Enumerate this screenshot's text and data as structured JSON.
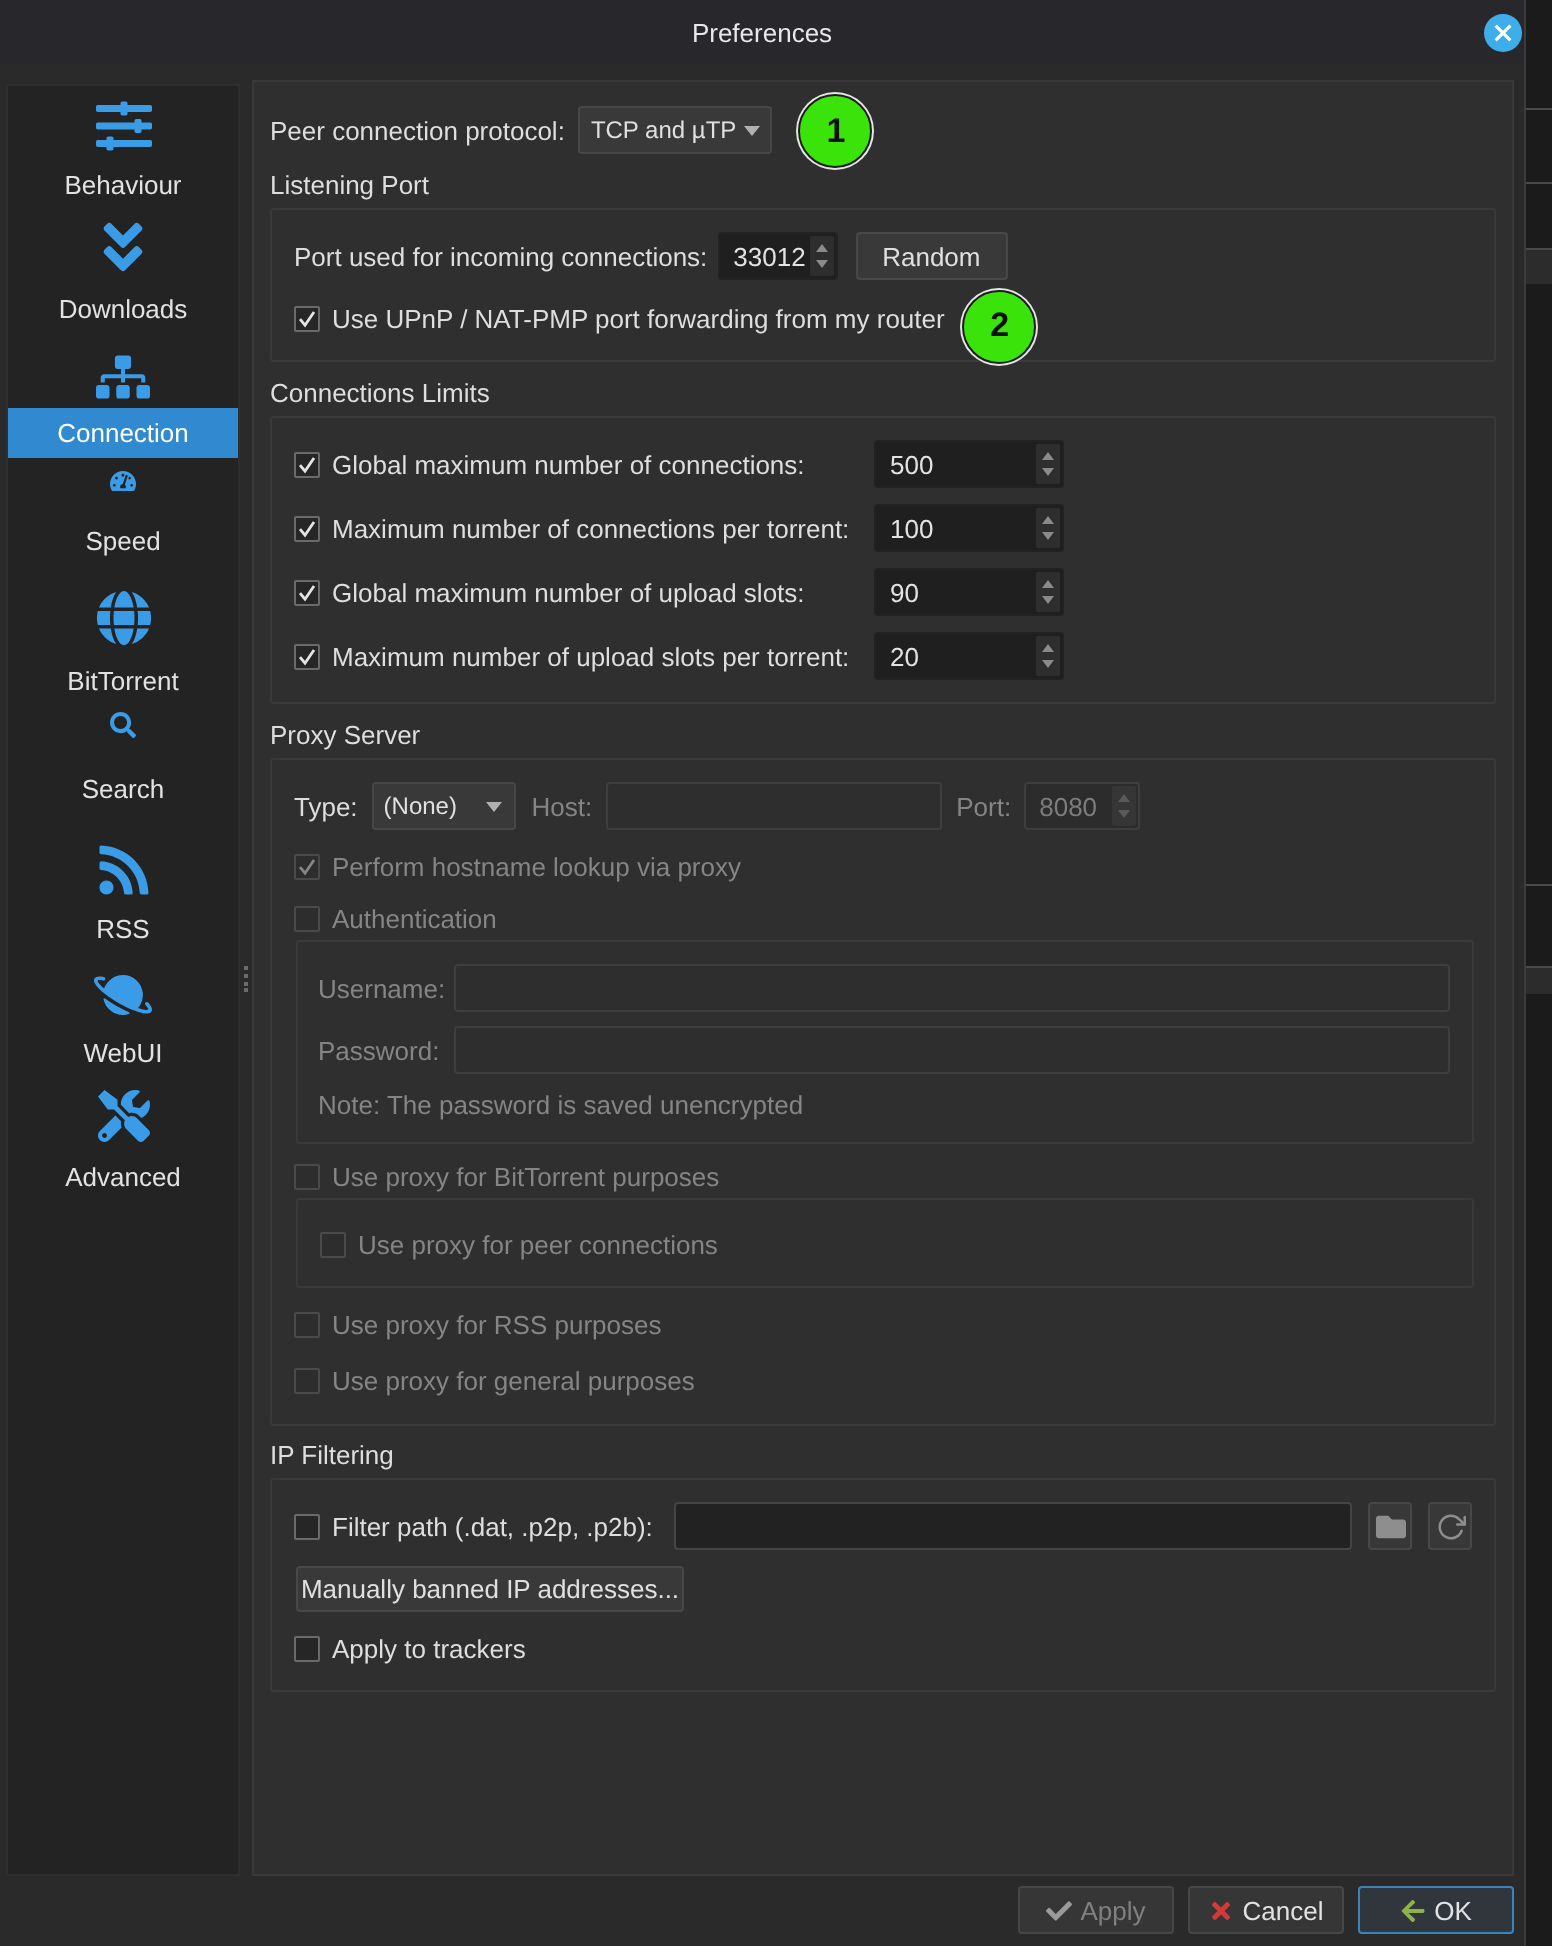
{
  "window": {
    "title": "Preferences"
  },
  "sidebar": {
    "items": [
      {
        "label": "Behaviour",
        "selected": false
      },
      {
        "label": "Downloads",
        "selected": false
      },
      {
        "label": "Connection",
        "selected": true
      },
      {
        "label": "Speed",
        "selected": false
      },
      {
        "label": "BitTorrent",
        "selected": false
      },
      {
        "label": "Search",
        "selected": false
      },
      {
        "label": "RSS",
        "selected": false
      },
      {
        "label": "WebUI",
        "selected": false
      },
      {
        "label": "Advanced",
        "selected": false
      }
    ]
  },
  "protocol": {
    "label": "Peer connection protocol:",
    "value": "TCP and µTP",
    "callout": "1"
  },
  "listening_port": {
    "title": "Listening Port",
    "port_label": "Port used for incoming connections:",
    "port_value": "33012",
    "random_button": "Random",
    "upnp": {
      "label": "Use UPnP / NAT-PMP port forwarding from my router",
      "checked": true,
      "callout": "2"
    }
  },
  "connection_limits": {
    "title": "Connections Limits",
    "rows": [
      {
        "label": "Global maximum number of connections:",
        "checked": true,
        "value": "500"
      },
      {
        "label": "Maximum number of connections per torrent:",
        "checked": true,
        "value": "100"
      },
      {
        "label": "Global maximum number of upload slots:",
        "checked": true,
        "value": "90"
      },
      {
        "label": "Maximum number of upload slots per torrent:",
        "checked": true,
        "value": "20"
      }
    ]
  },
  "proxy_server": {
    "title": "Proxy Server",
    "type_label": "Type:",
    "type_value": "(None)",
    "host": {
      "label": "Host:",
      "disabled": true
    },
    "port": {
      "label": "Port:",
      "value": "8080",
      "disabled": true
    },
    "hostname_lookup": {
      "label": "Perform hostname lookup via proxy",
      "checked": true,
      "disabled": true
    },
    "authentication": {
      "label": "Authentication",
      "checked": false,
      "disabled": true,
      "username_label": "Username:",
      "password_label": "Password:",
      "note": "Note: The password is saved unencrypted"
    },
    "bittorrent": {
      "label": "Use proxy for BitTorrent purposes",
      "checked": false,
      "disabled": true,
      "peer_connections": {
        "label": "Use proxy for peer connections",
        "checked": false,
        "disabled": true
      }
    },
    "rss": {
      "label": "Use proxy for RSS purposes",
      "checked": false,
      "disabled": true
    },
    "general": {
      "label": "Use proxy for general purposes",
      "checked": false,
      "disabled": true
    }
  },
  "ip_filtering": {
    "title": "IP Filtering",
    "filter_path": {
      "label": "Filter path (.dat, .p2p, .p2b):",
      "checked": false
    },
    "banned_button": "Manually banned IP addresses...",
    "apply_to_trackers": {
      "label": "Apply to trackers",
      "checked": false
    }
  },
  "buttons": [
    {
      "label": "Apply",
      "kind": "apply",
      "disabled": true,
      "default": false
    },
    {
      "label": "Cancel",
      "kind": "cancel",
      "disabled": false,
      "default": false
    },
    {
      "label": "OK",
      "kind": "ok",
      "disabled": false,
      "default": true
    }
  ]
}
